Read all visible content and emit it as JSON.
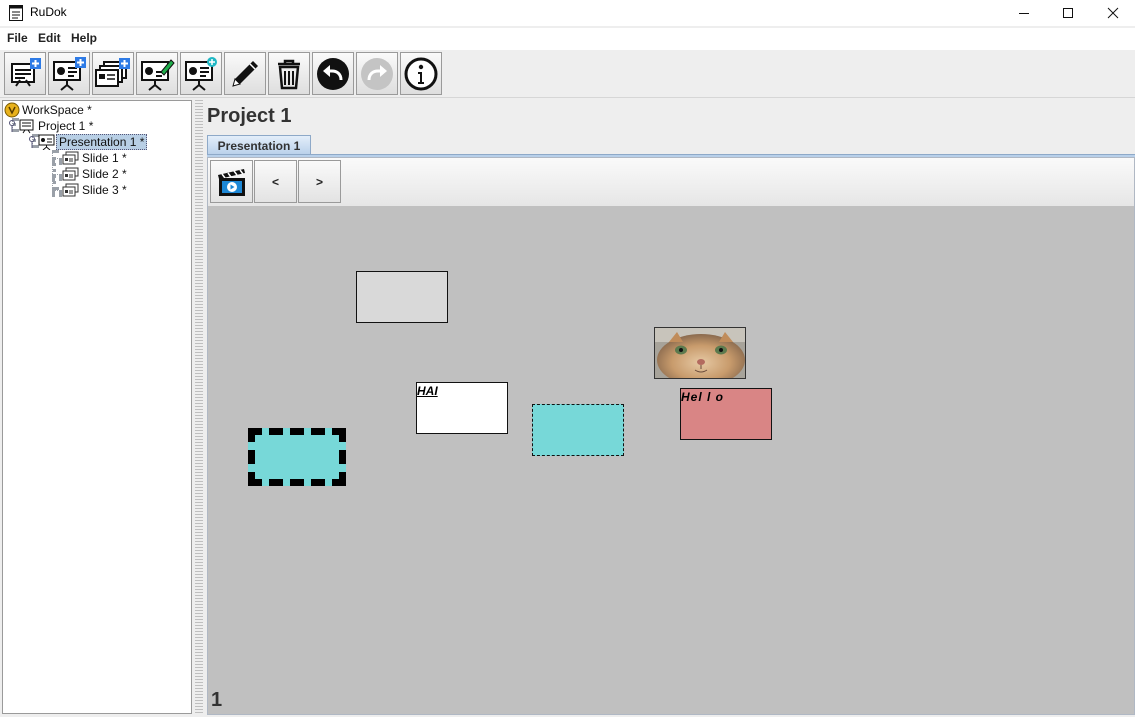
{
  "window": {
    "title": "RuDok"
  },
  "menu": {
    "file": "File",
    "edit": "Edit",
    "help": "Help"
  },
  "toolbar": {
    "buttons": [
      {
        "icon": "new-project-icon"
      },
      {
        "icon": "new-presentation-icon"
      },
      {
        "icon": "new-slide-icon"
      },
      {
        "icon": "edit-presentation-icon"
      },
      {
        "icon": "share-presentation-icon"
      },
      {
        "icon": "pencil-icon"
      },
      {
        "icon": "trash-icon"
      },
      {
        "icon": "undo-icon"
      },
      {
        "icon": "redo-icon",
        "disabled": true
      },
      {
        "icon": "info-icon"
      }
    ]
  },
  "tree": {
    "workspace": "WorkSpace *",
    "project": "Project 1 *",
    "presentation": "Presentation 1 *",
    "slides": [
      "Slide 1 *",
      "Slide 2 *",
      "Slide 3 *"
    ]
  },
  "main": {
    "project_title": "Project 1",
    "tab_label": "Presentation 1",
    "nav": {
      "prev": "<",
      "next": ">"
    },
    "slide_number": "1",
    "slots": [
      {
        "kind": "rectangle",
        "color": "#d9d9d9",
        "border": "solid"
      },
      {
        "kind": "text",
        "color": "#ffffff",
        "border": "solid",
        "text": "HAI"
      },
      {
        "kind": "image",
        "icon": "cat-photo"
      },
      {
        "kind": "text",
        "color": "#d98585",
        "border": "solid",
        "text": "Hel l o"
      },
      {
        "kind": "rectangle",
        "color": "#77d8d8",
        "border": "dashed"
      },
      {
        "kind": "rectangle",
        "color": "#77d8d8",
        "border": "thick-dotted"
      }
    ]
  },
  "colors": {
    "slide_bg": "#c0c0c0",
    "tab_bg": "#b8d0ea",
    "selection": "#b8cfe5"
  }
}
